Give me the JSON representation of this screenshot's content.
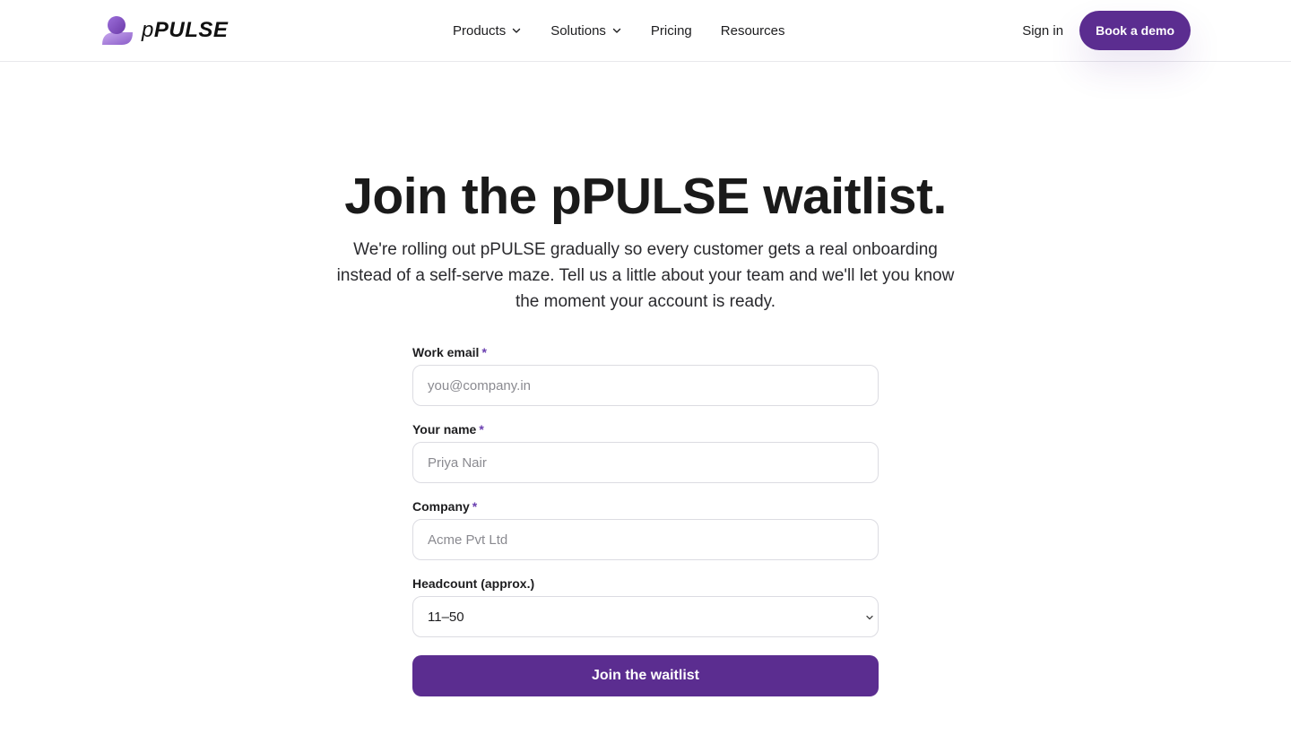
{
  "brand": {
    "name_prefix": "p",
    "name_main": "PULSE",
    "accent": "#5b2d90"
  },
  "nav": {
    "items": [
      {
        "label": "Products",
        "has_dropdown": true
      },
      {
        "label": "Solutions",
        "has_dropdown": true
      },
      {
        "label": "Pricing",
        "has_dropdown": false
      },
      {
        "label": "Resources",
        "has_dropdown": false
      }
    ],
    "signin": "Sign in",
    "demo": "Book a demo"
  },
  "hero": {
    "title": "Join the pPULSE waitlist.",
    "subtitle": "We're rolling out pPULSE gradually so every customer gets a real onboarding instead of a self-serve maze. Tell us a little about your team and we'll let you know the moment your account is ready."
  },
  "form": {
    "email": {
      "label": "Work email",
      "required": "*",
      "placeholder": "you@company.in",
      "value": ""
    },
    "name": {
      "label": "Your name",
      "required": "*",
      "placeholder": "Priya Nair",
      "value": ""
    },
    "company": {
      "label": "Company",
      "required": "*",
      "placeholder": "Acme Pvt Ltd",
      "value": ""
    },
    "headcount": {
      "label": "Headcount (approx.)",
      "selected": "11–50"
    },
    "submit": "Join the waitlist"
  },
  "icons": {
    "logo": "logo-mark",
    "nav_dropdown": "chevron-down-icon",
    "select_dropdown": "chevron-down-icon"
  }
}
